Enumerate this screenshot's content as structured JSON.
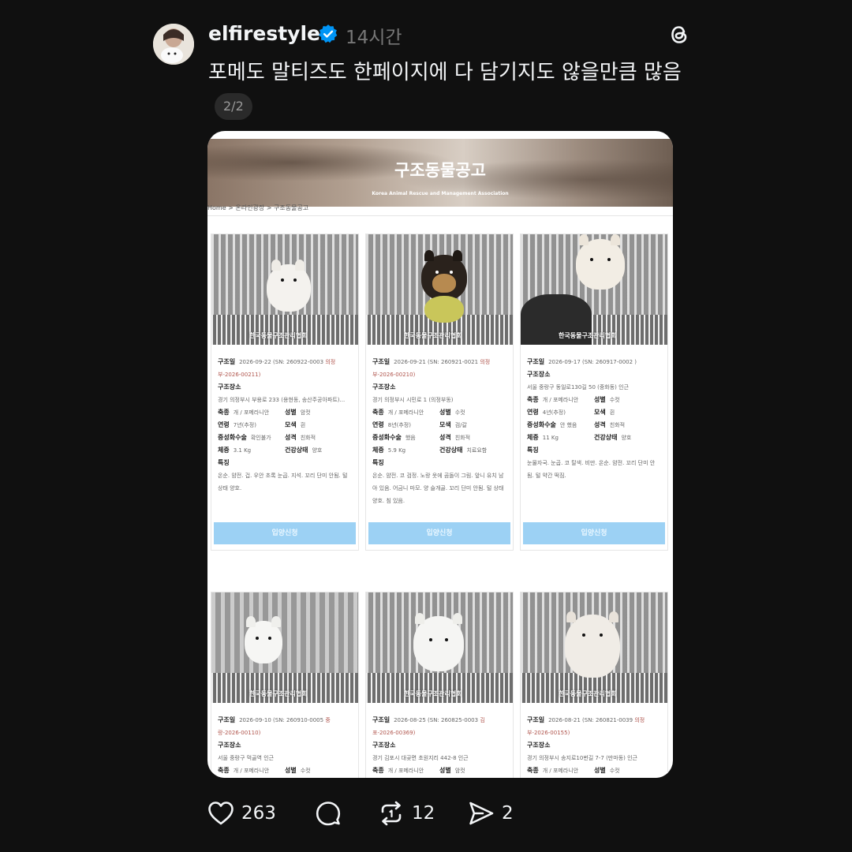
{
  "post": {
    "username": "elfirestyle",
    "time": "14시간",
    "text": "포메도 말티즈도 한페이지에 다 담기지도 않을만큼 많음",
    "page_indicator": "2/2"
  },
  "screenshot": {
    "banner_title": "구조동물공고",
    "banner_subtitle": "Korea Animal Rescue and Management Association",
    "breadcrumb": "Home > 온라인광장 > 구조동물공고",
    "watermark": "한국동물구조관리협회",
    "labels": {
      "rescue_date": "구조일",
      "place": "구조장소",
      "breed": "축종",
      "sex": "성별",
      "age": "연령",
      "color": "모색",
      "neuter": "중성화수술",
      "personality": "성격",
      "weight": "체중",
      "health": "건강상태",
      "features": "특징"
    },
    "adopt_label": "입양신청",
    "cards": [
      {
        "date": "2026-09-22",
        "sn": "(SN: 260922-0003",
        "sn_red": "의정부-2026-00211)",
        "place": "경기 의정부시 부용로 233 (용현동, 송산주공아파트)...",
        "breed": "개 / 포메라니안",
        "sex": "암컷",
        "age": "7년(추정)",
        "color": "흰",
        "neuter": "확인불가",
        "personality": "친화적",
        "weight": "3.1 Kg",
        "health": "양호",
        "features": "온순. 얌전. 겁. 우안 초록 눈곱. 지석. 꼬리 단미 안됨. 털 상태 양호."
      },
      {
        "date": "2026-09-21",
        "sn": "(SN: 260921-0021",
        "sn_red": "의정부-2026-00210)",
        "place": "경기 의정부시 시민로 1 (의정부동)",
        "breed": "개 / 포메라니안",
        "sex": "수컷",
        "age": "8년(추정)",
        "color": "검/갈",
        "neuter": "했음",
        "personality": "친화적",
        "weight": "5.9 Kg",
        "health": "치료요함",
        "features": "온순. 얌전. 코 검정. 노랑 옷에 곰돌이 그림. 앞니 유치 남아 있음. 어금니 마모. 양 슬개골. 꼬리 단미 안됨. 털 상태 양호. 침 있음."
      },
      {
        "date": "2026-09-17",
        "sn": "(SN: 260917-0002 )",
        "sn_red": "",
        "place": "서울 중랑구 동일로130길 50 (중화동) 인근",
        "breed": "개 / 포메라니안",
        "sex": "수컷",
        "age": "4년(추정)",
        "color": "흰",
        "neuter": "안 했음",
        "personality": "친화적",
        "weight": "11 Kg",
        "health": "양호",
        "features": "눈물자국. 눈곱. 코 탈색. 비만. 온순. 얌전. 꼬리 단미 안됨. 털 약간 떡짐."
      },
      {
        "date": "2026-09-10",
        "sn": "(SN: 260910-0005",
        "sn_red": "중랑-2026-00110)",
        "place": "서울 중랑구 먹골역 인근",
        "breed": "개 / 포메라니안",
        "sex": "수컷"
      },
      {
        "date": "2026-08-25",
        "sn": "(SN: 260825-0003",
        "sn_red": "김포-2026-00369)",
        "place": "경기 김포시 대곶면 초원지리 442-8 인근",
        "breed": "개 / 포메라니안",
        "sex": "암컷"
      },
      {
        "date": "2026-08-21",
        "sn": "(SN: 260821-0039",
        "sn_red": "의정부-2026-00155)",
        "place": "경기 의정부시 송지로10번길 7-7 (만마동) 인근",
        "breed": "개 / 포메라니안",
        "sex": "수컷"
      }
    ]
  },
  "actions": {
    "likes": "263",
    "replies": "",
    "reposts": "12",
    "shares": "2"
  },
  "colors": {
    "background": "#101010",
    "verified": "#0095f6",
    "adopt_button": "#9cd1f4"
  }
}
